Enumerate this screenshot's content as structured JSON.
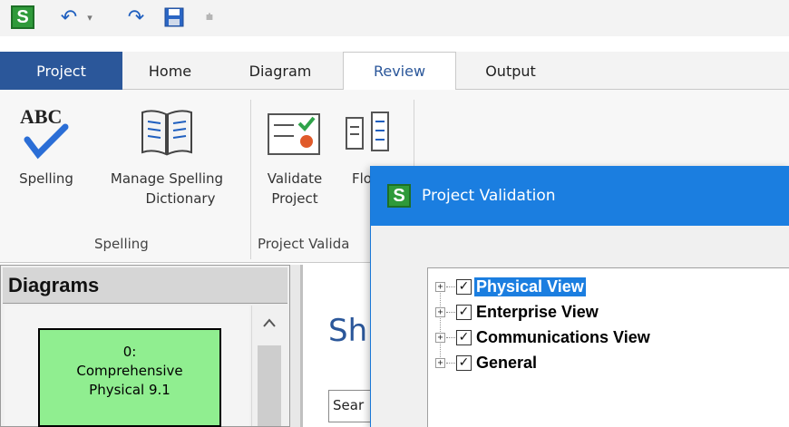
{
  "quick_access": {
    "app_icon_letter": "S",
    "undo_glyph": "↶",
    "dropdown_glyph": "▾",
    "redo_glyph": "↷",
    "save_glyph": "💾",
    "customize_glyph": "⩧"
  },
  "tabs": [
    {
      "label": "Project"
    },
    {
      "label": "Home"
    },
    {
      "label": "Diagram"
    },
    {
      "label": "Review"
    },
    {
      "label": "Output"
    }
  ],
  "ribbon": {
    "spelling": {
      "label": "Spelling",
      "icon_text": "ABC"
    },
    "manage_spelling": {
      "label_line1": "Manage Spelling",
      "label_line2": "Dictionary"
    },
    "validate": {
      "label_line1": "Validate",
      "label_line2": "Project"
    },
    "flow": {
      "label": "Flo"
    },
    "groups": {
      "spelling": "Spelling",
      "project_validation": "Project Valida"
    }
  },
  "diagrams_panel": {
    "title": "Diagrams",
    "card": {
      "line1": "0:",
      "line2": "Comprehensive",
      "line3": "Physical 9.1"
    }
  },
  "document": {
    "title_fragment": "Sh",
    "search_fragment": "Sear"
  },
  "dialog": {
    "icon_letter": "S",
    "title": "Project Validation",
    "tree": [
      {
        "label": "Physical View",
        "checked": true,
        "selected": true
      },
      {
        "label": "Enterprise View",
        "checked": true,
        "selected": false
      },
      {
        "label": "Communications View",
        "checked": true,
        "selected": false
      },
      {
        "label": "General",
        "checked": true,
        "selected": false
      }
    ]
  },
  "colors": {
    "accent_blue": "#2b579a",
    "dialog_title_blue": "#1b7ee0",
    "app_green": "#2f9a3a",
    "diagram_card_green": "#90ee90"
  }
}
